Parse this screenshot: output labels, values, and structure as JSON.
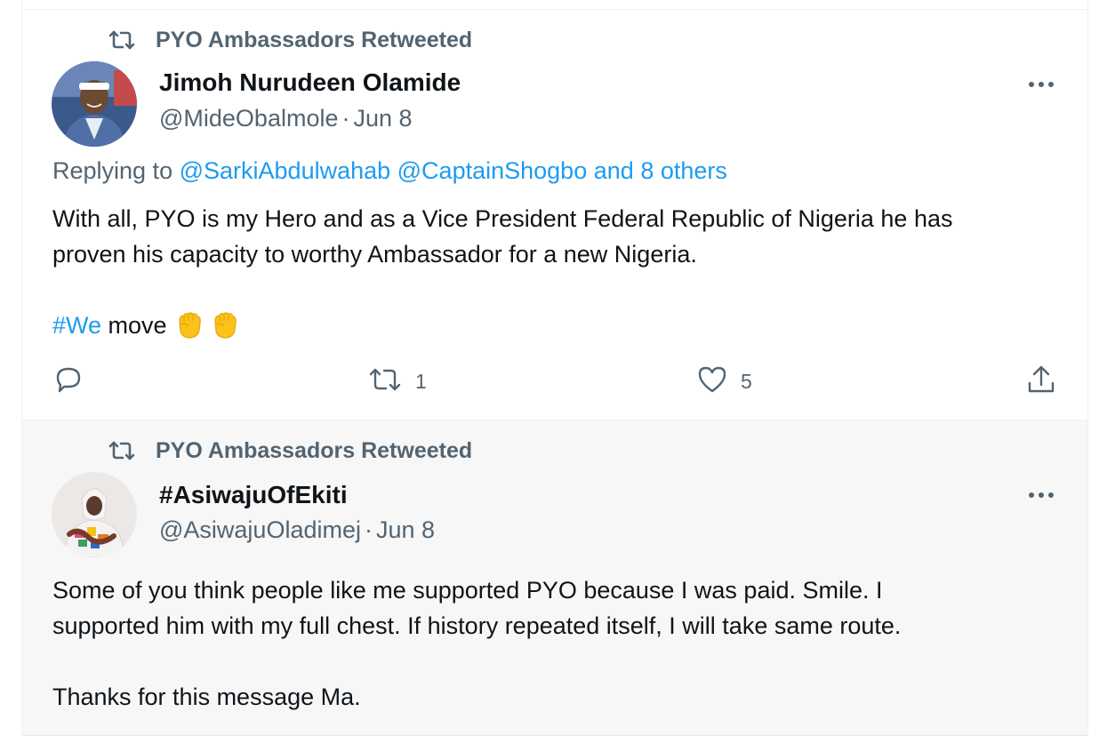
{
  "colors": {
    "link": "#1d9bf0",
    "muted": "#536471",
    "text": "#0f1419"
  },
  "tweets": [
    {
      "retweeted_by": "PYO Ambassadors Retweeted",
      "author_name": "Jimoh Nurudeen Olamide",
      "handle": "@MideObalmole",
      "date": "Jun 8",
      "replying_prefix": "Replying to",
      "replying_users": "@SarkiAbdulwahab @CaptainShogbo",
      "replying_and": "and",
      "replying_others": "8 others",
      "body_lines": [
        "With all, PYO is my Hero and as a Vice President Federal Republic of Nigeria he has",
        "proven his capacity to worthy Ambassador for a new Nigeria."
      ],
      "hashtag": "#We",
      "hashtag_rest": "move",
      "emojis": [
        "fist-emoji",
        "fist-emoji"
      ],
      "actions": {
        "reply_count": "",
        "retweet_count": "1",
        "like_count": "5"
      }
    },
    {
      "retweeted_by": "PYO Ambassadors Retweeted",
      "author_name": "#AsiwajuOfEkiti",
      "handle": "@AsiwajuOladimej",
      "date": "Jun 8",
      "body_lines": [
        "Some of you think people like me supported PYO because I was paid. Smile. I",
        "supported him with my full chest. If history repeated itself, I will take same route."
      ],
      "body_last": "Thanks for this message Ma."
    }
  ]
}
